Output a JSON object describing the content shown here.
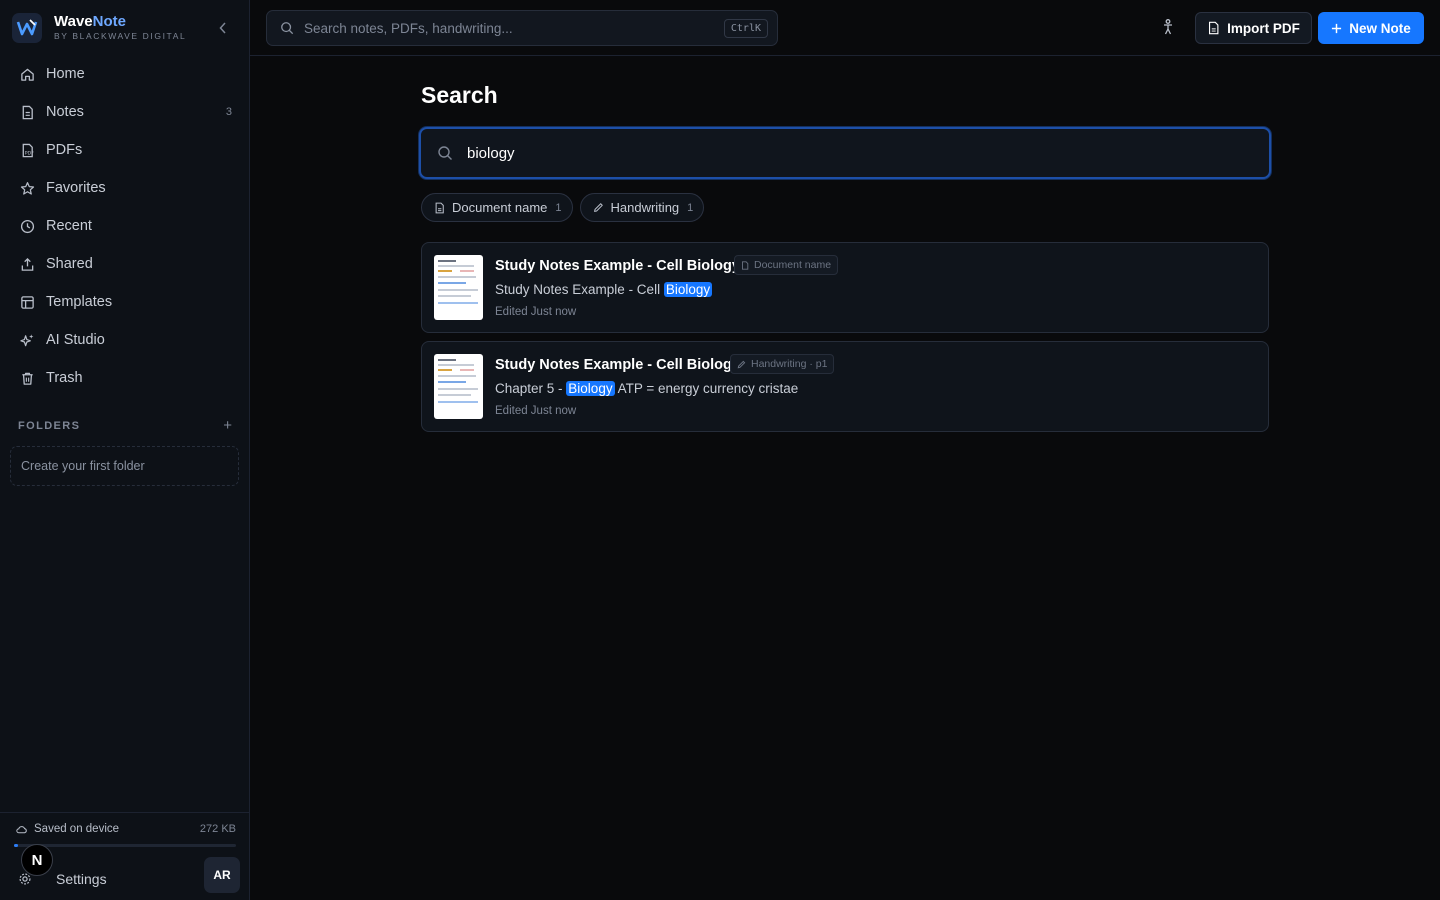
{
  "brand": {
    "name_main": "Wave",
    "name_accent": "Note",
    "sub": "BY BLACKWAVE DIGITAL"
  },
  "nav": [
    {
      "label": "Home",
      "count": ""
    },
    {
      "label": "Notes",
      "count": "3"
    },
    {
      "label": "PDFs",
      "count": ""
    },
    {
      "label": "Favorites",
      "count": ""
    },
    {
      "label": "Recent",
      "count": ""
    },
    {
      "label": "Shared",
      "count": ""
    },
    {
      "label": "Templates",
      "count": ""
    },
    {
      "label": "AI Studio",
      "count": ""
    },
    {
      "label": "Trash",
      "count": ""
    }
  ],
  "folders": {
    "label": "FOLDERS",
    "empty": "Create your first folder"
  },
  "storage": {
    "label": "Saved on device",
    "size": "272 KB",
    "used_fraction": 0.02
  },
  "settings": {
    "label": "Settings",
    "avatar": "AR",
    "badge": "N"
  },
  "topbar": {
    "search_placeholder": "Search notes, PDFs, handwriting...",
    "shortcut": "CtrlK",
    "import_label": "Import PDF",
    "new_label": "New Note"
  },
  "search": {
    "title": "Search",
    "query": "biology",
    "filters": [
      {
        "label": "Document name",
        "count": "1"
      },
      {
        "label": "Handwriting",
        "count": "1"
      }
    ],
    "results": [
      {
        "title": "Study Notes Example - Cell Biology",
        "tag": "Document name",
        "snippet_before": "Study Notes Example - Cell ",
        "snippet_match": "Biology",
        "snippet_after": "",
        "edited": "Edited Just now"
      },
      {
        "title": "Study Notes Example - Cell Biology",
        "tag": "Handwriting · p1",
        "snippet_before": "Chapter 5 - ",
        "snippet_match": "Biology",
        "snippet_after": " ATP = energy currency cristae",
        "edited": "Edited Just now"
      }
    ]
  },
  "colors": {
    "accent": "#1677ff",
    "background": "#090a0c",
    "sidebar": "#0d1117"
  }
}
